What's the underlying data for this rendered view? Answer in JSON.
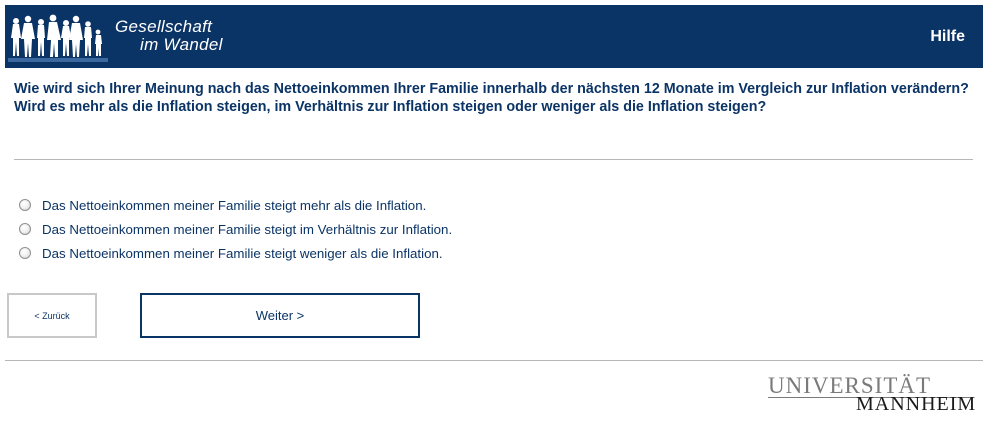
{
  "header": {
    "logo_line1": "Gesellschaft",
    "logo_line2": "im Wandel",
    "help_label": "Hilfe",
    "background_color": "#0b3466"
  },
  "question": {
    "text": "Wie wird sich Ihrer Meinung nach das Nettoeinkommen Ihrer Familie innerhalb der nächsten 12 Monate im Vergleich zur Inflation verändern? Wird es mehr als die Inflation steigen, im Verhältnis zur Inflation steigen oder weniger als die Inflation steigen?"
  },
  "options": [
    {
      "label": "Das Nettoeinkommen meiner Familie steigt mehr als die Inflation.",
      "selected": false
    },
    {
      "label": "Das Nettoeinkommen meiner Familie steigt im Verhältnis zur Inflation.",
      "selected": false
    },
    {
      "label": "Das Nettoeinkommen meiner Familie steigt weniger als die Inflation.",
      "selected": false
    }
  ],
  "nav": {
    "back_label": "< Zurück",
    "next_label": "Weiter >"
  },
  "footer": {
    "logo_top": "UNIVERSITÄT",
    "logo_bottom": "MANNHEIM"
  }
}
